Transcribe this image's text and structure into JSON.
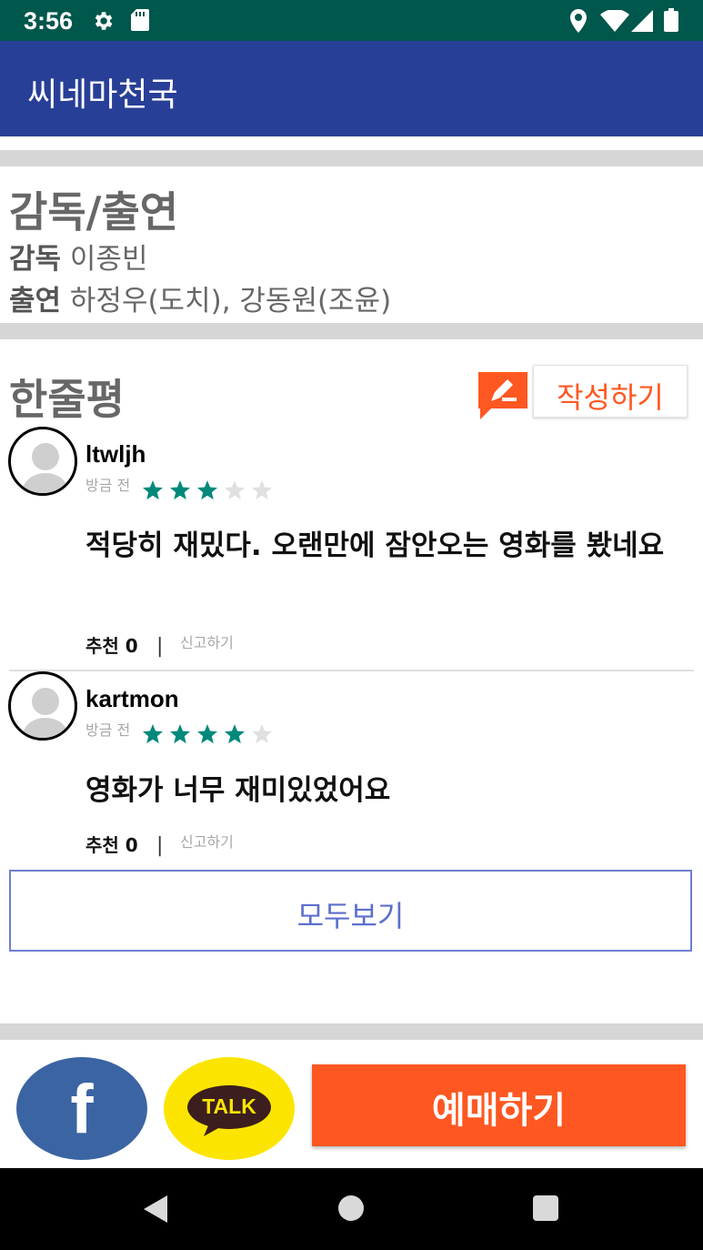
{
  "status_bar": {
    "time": "3:56",
    "icons": [
      "gear-icon",
      "sd-card-icon",
      "location-icon",
      "wifi-icon",
      "cell-signal-icon",
      "battery-icon"
    ]
  },
  "app_bar": {
    "title": "씨네마천국"
  },
  "cast": {
    "heading": "감독/출연",
    "director_label": "감독",
    "director_value": "이종빈",
    "cast_label": "출연",
    "cast_value": "하정우(도치), 강동원(조윤)"
  },
  "reviews": {
    "heading": "한줄평",
    "write_label": "작성하기",
    "items": [
      {
        "user": "ltwljh",
        "time": "방금 전",
        "rating": 3.5,
        "comment": "적당히 재밌다. 오랜만에 잠안오는 영화를 봤네요",
        "recommend_label": "추천",
        "recommend_count": "0",
        "separator": "|",
        "report_label": "신고하기"
      },
      {
        "user": "kartmon",
        "time": "방금 전",
        "rating": 4.5,
        "comment": "영화가 너무 재미있었어요",
        "recommend_label": "추천",
        "recommend_count": "0",
        "separator": "|",
        "report_label": "신고하기"
      }
    ],
    "view_all_label": "모두보기"
  },
  "actions": {
    "facebook_letter": "f",
    "kakao_label": "TALK",
    "book_label": "예매하기"
  },
  "colors": {
    "status_bar": "#00574b",
    "app_bar": "#283f97",
    "accent": "#ff5722",
    "star": "#00897b",
    "facebook": "#3b64a3",
    "kakao": "#fbe500"
  }
}
